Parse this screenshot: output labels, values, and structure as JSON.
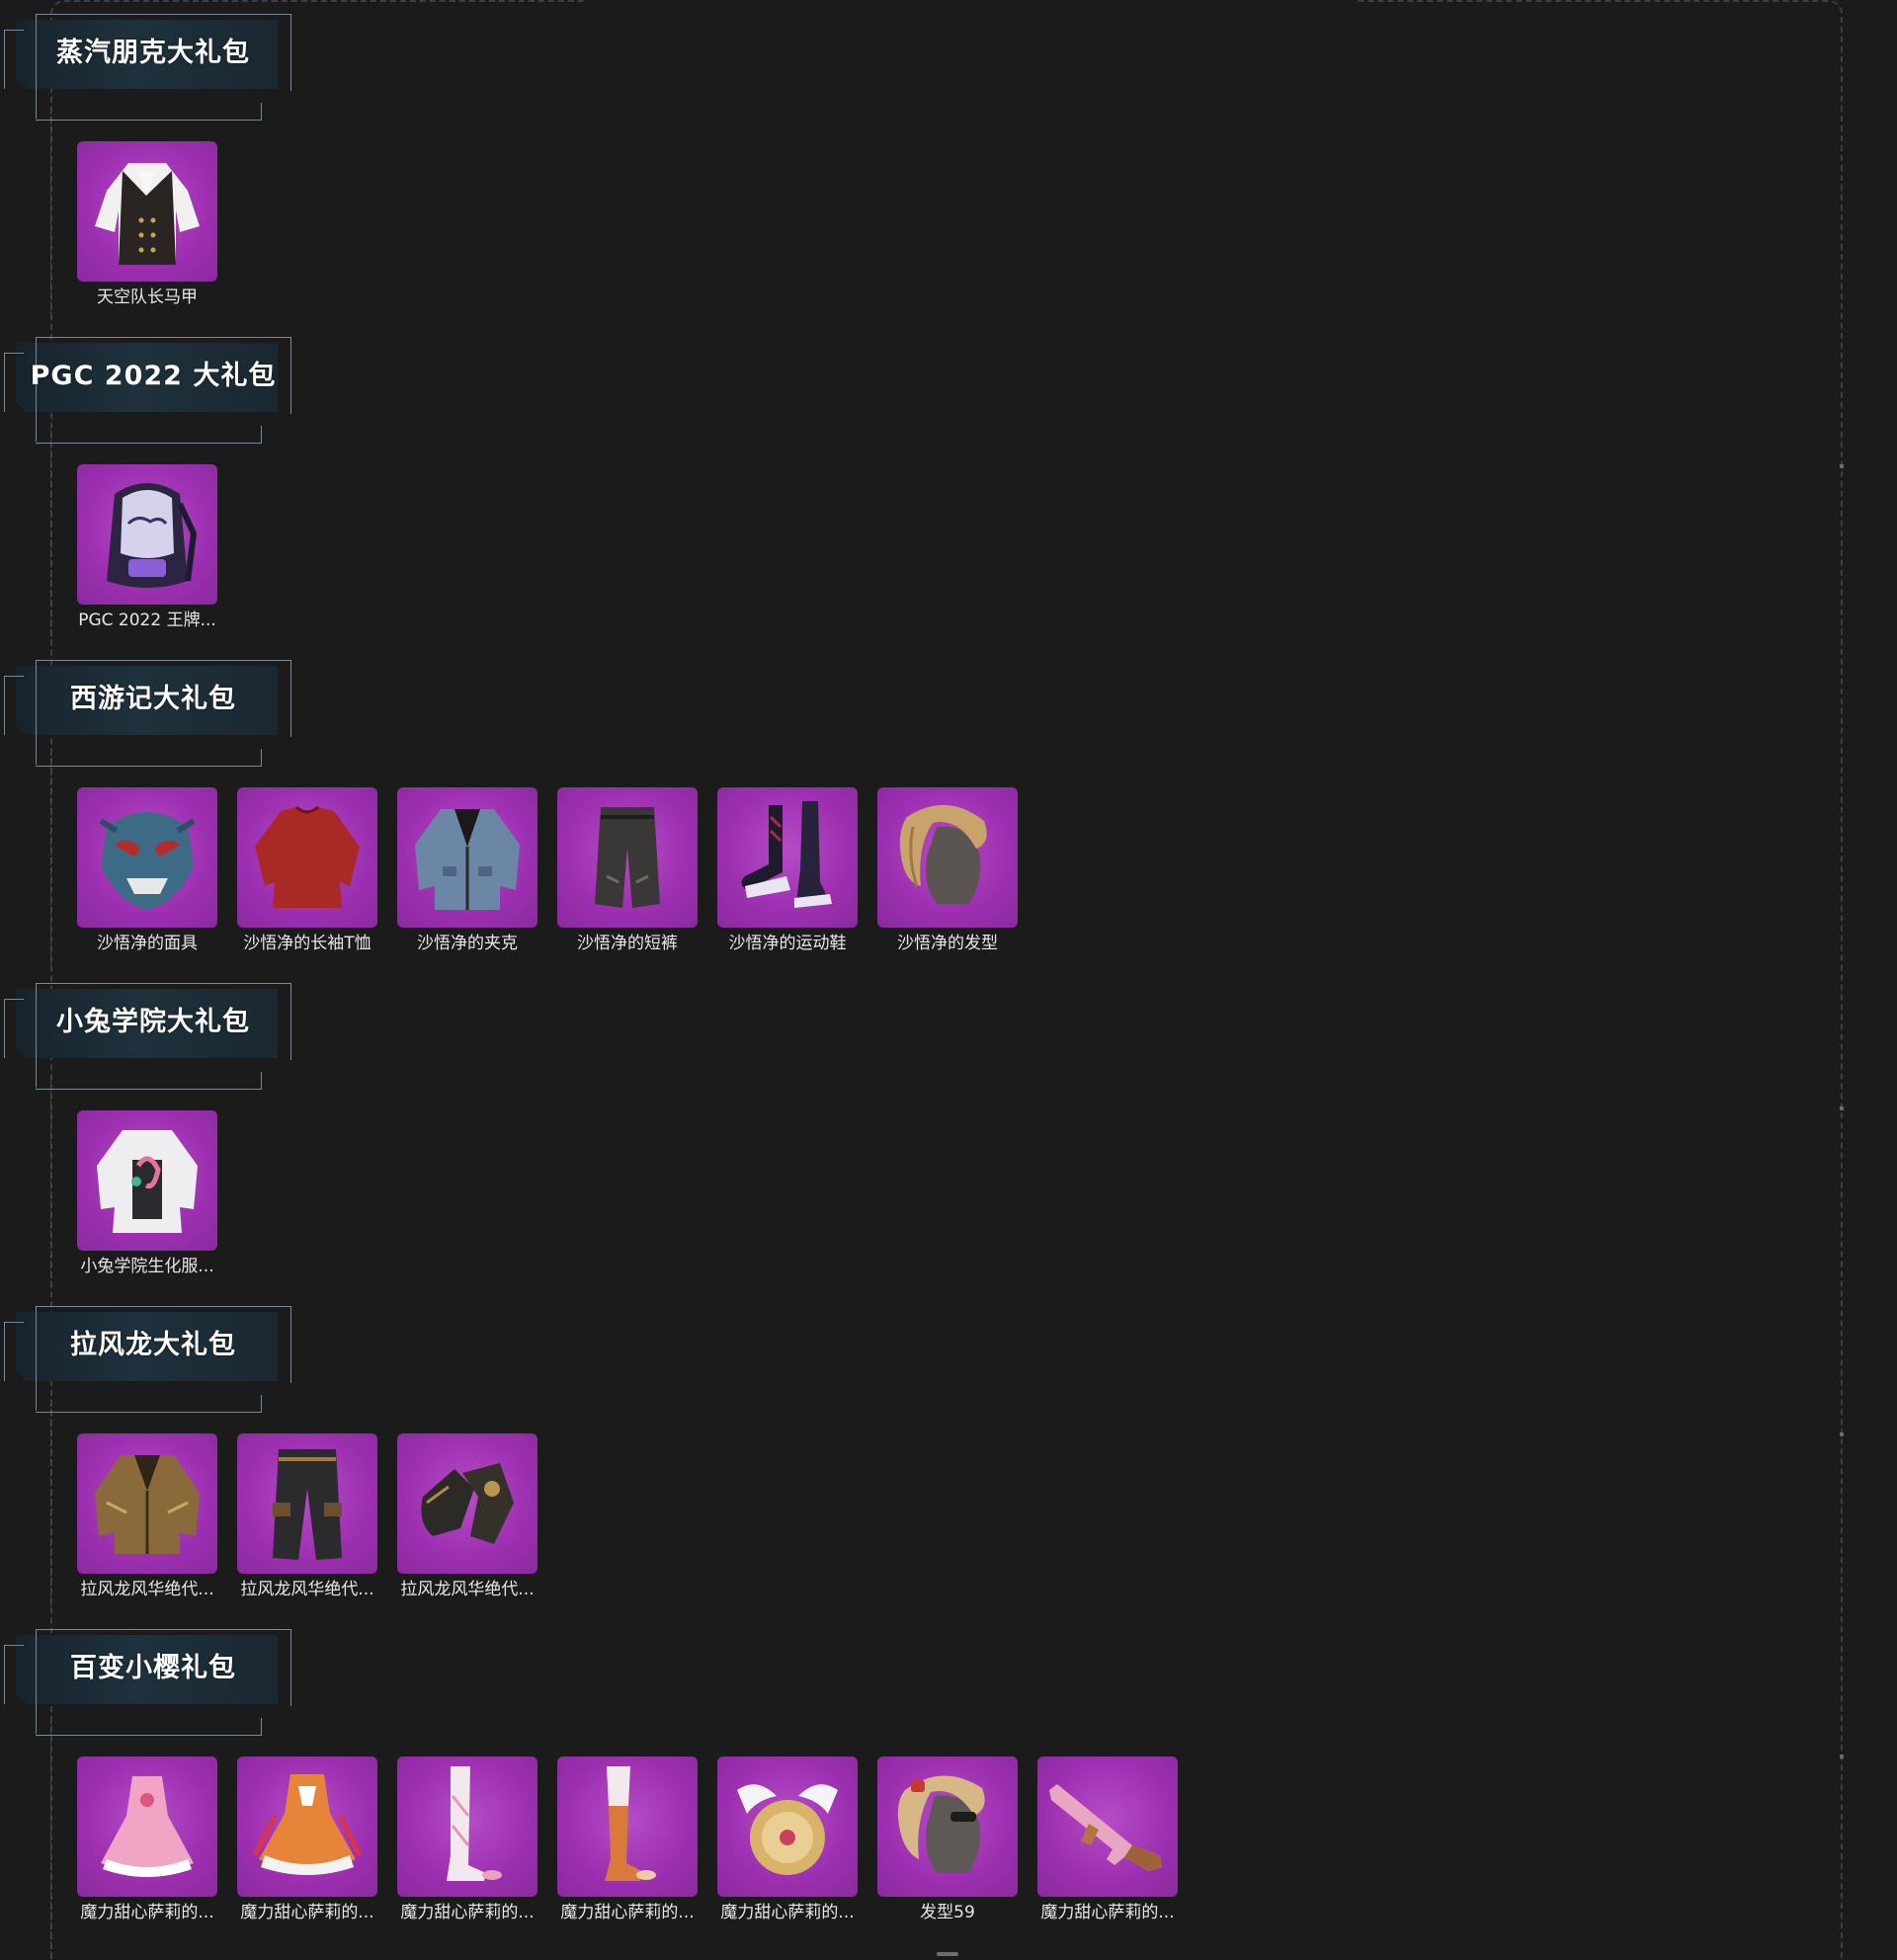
{
  "sections": [
    {
      "title": "蒸汽朋克大礼包",
      "items": [
        {
          "label": "天空队长马甲",
          "icon": "vest-icon"
        }
      ]
    },
    {
      "title": "PGC 2022 大礼包",
      "items": [
        {
          "label": "PGC 2022 王牌...",
          "icon": "backpack-icon"
        }
      ]
    },
    {
      "title": "西游记大礼包",
      "items": [
        {
          "label": "沙悟净的面具",
          "icon": "mask-icon"
        },
        {
          "label": "沙悟净的长袖T恤",
          "icon": "shirt-icon"
        },
        {
          "label": "沙悟净的夹克",
          "icon": "jacket-icon"
        },
        {
          "label": "沙悟净的短裤",
          "icon": "shorts-icon"
        },
        {
          "label": "沙悟净的运动鞋",
          "icon": "sneakers-icon"
        },
        {
          "label": "沙悟净的发型",
          "icon": "hairstyle-icon"
        }
      ]
    },
    {
      "title": "小兔学院大礼包",
      "items": [
        {
          "label": "小兔学院生化服...",
          "icon": "hazmat-suit-icon"
        }
      ]
    },
    {
      "title": "拉风龙大礼包",
      "items": [
        {
          "label": "拉风龙风华绝代...",
          "icon": "gold-jacket-icon"
        },
        {
          "label": "拉风龙风华绝代...",
          "icon": "pants-icon"
        },
        {
          "label": "拉风龙风华绝代...",
          "icon": "gloves-icon"
        }
      ]
    },
    {
      "title": "百变小樱礼包",
      "items": [
        {
          "label": "魔力甜心萨莉的...",
          "icon": "pink-dress-icon"
        },
        {
          "label": "魔力甜心萨莉的...",
          "icon": "orange-dress-icon"
        },
        {
          "label": "魔力甜心萨莉的...",
          "icon": "white-boots-icon"
        },
        {
          "label": "魔力甜心萨莉的...",
          "icon": "orange-boots-icon"
        },
        {
          "label": "魔力甜心萨莉的...",
          "icon": "winged-backpack-icon"
        },
        {
          "label": "发型59",
          "icon": "blonde-hair-icon"
        },
        {
          "label": "魔力甜心萨莉的...",
          "icon": "rifle-icon"
        }
      ]
    }
  ],
  "colors": {
    "background": "#1b1b1c",
    "item_bg": "#9c2fb0",
    "header_bg": "#1e313c",
    "text": "#e8e8e8"
  }
}
